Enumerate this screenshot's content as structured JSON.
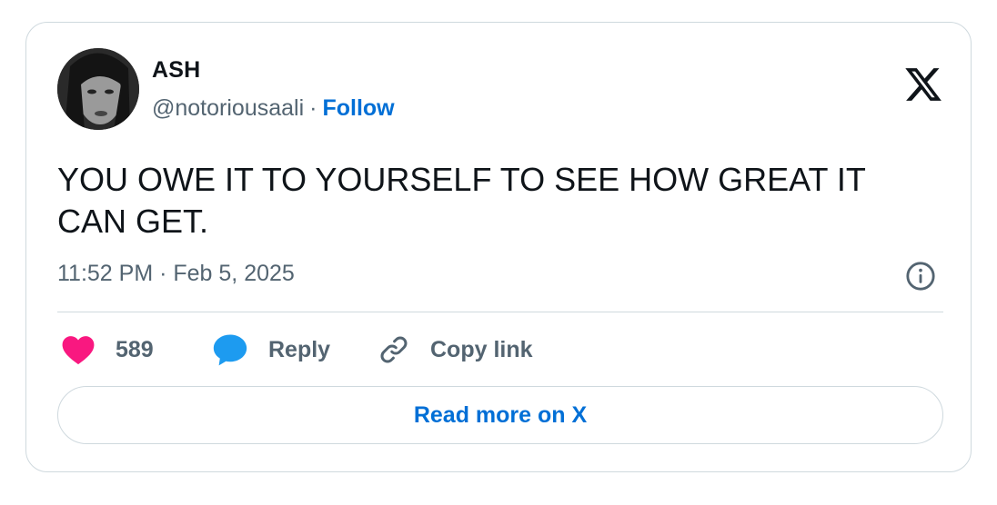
{
  "author": {
    "name": "ASH",
    "handle": "@notoriousaali",
    "separator": "·",
    "follow_label": "Follow"
  },
  "tweet": {
    "text": "YOU OWE IT TO YOURSELF TO SEE HOW GREAT IT CAN GET.",
    "timestamp": "11:52 PM · Feb 5, 2025"
  },
  "actions": {
    "like_count": "589",
    "reply_label": "Reply",
    "copy_link_label": "Copy link"
  },
  "footer": {
    "read_more_label": "Read more on X"
  },
  "icons": {
    "brand": "x-logo-icon",
    "info": "info-icon",
    "like": "heart-icon",
    "reply": "speech-bubble-icon",
    "copy": "link-icon"
  },
  "colors": {
    "accent": "#006fd6",
    "like": "#f91880",
    "reply": "#1d9bf0",
    "muted_text": "#536471",
    "border": "#cfd9de"
  }
}
